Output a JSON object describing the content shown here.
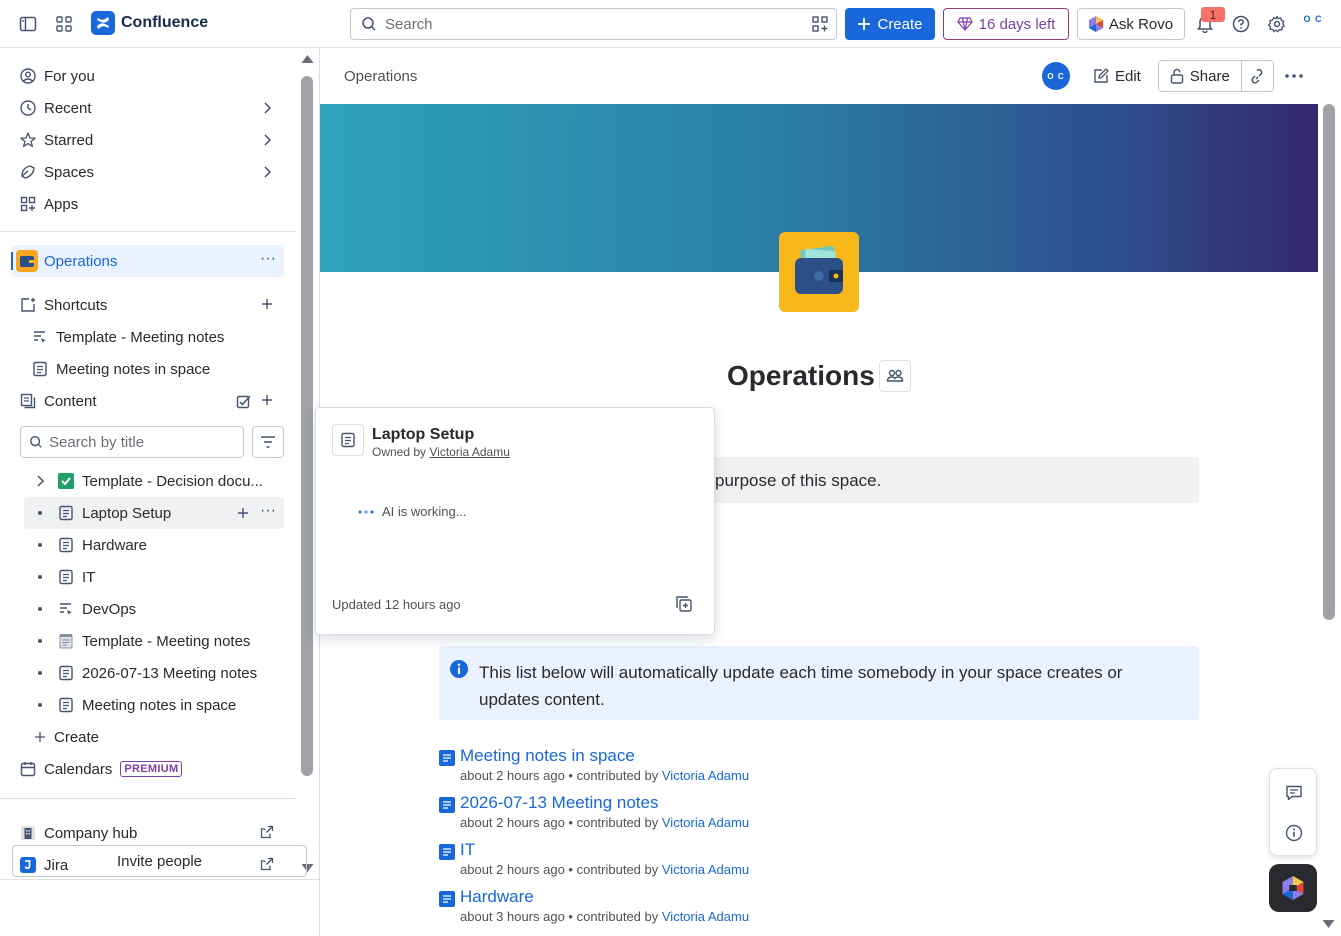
{
  "topbar": {
    "app_name": "Confluence",
    "search_placeholder": "Search",
    "create_label": "Create",
    "trial_label": "16 days left",
    "rovo_label": "Ask Rovo",
    "notification_count": "1",
    "profile_initials": "O C"
  },
  "sidebar": {
    "nav": [
      {
        "label": "For you"
      },
      {
        "label": "Recent"
      },
      {
        "label": "Starred"
      },
      {
        "label": "Spaces"
      },
      {
        "label": "Apps"
      }
    ],
    "space_name": "Operations",
    "shortcuts_label": "Shortcuts",
    "shortcuts": [
      {
        "label": "Template - Meeting notes"
      },
      {
        "label": "Meeting notes in space"
      }
    ],
    "content_label": "Content",
    "search_title_placeholder": "Search by title",
    "tree": [
      {
        "label": "Template - Decision docu..."
      },
      {
        "label": "Laptop Setup"
      },
      {
        "label": "Hardware"
      },
      {
        "label": "IT"
      },
      {
        "label": "DevOps"
      },
      {
        "label": "Template - Meeting notes"
      },
      {
        "label": "2026-07-13 Meeting notes"
      },
      {
        "label": "Meeting notes in space"
      }
    ],
    "create_label": "Create",
    "calendars_label": "Calendars",
    "premium_badge": "PREMIUM",
    "company_hub_label": "Company hub",
    "jira_label": "Jira",
    "invite_label": "Invite people"
  },
  "main": {
    "breadcrumb": "Operations",
    "avatar_initials": "O C",
    "edit_label": "Edit",
    "share_label": "Share",
    "title": "Operations",
    "purpose_text": "purpose of this space.",
    "info_text": "This list below will automatically update each time somebody in your space creates or updates content.",
    "items": [
      {
        "title": "Meeting notes in space",
        "time": "about 2 hours ago",
        "sep": " • contributed by ",
        "who": "Victoria Adamu"
      },
      {
        "title": "2026-07-13 Meeting notes",
        "time": "about 2 hours ago",
        "sep": " • contributed by ",
        "who": "Victoria Adamu"
      },
      {
        "title": "IT",
        "time": "about 2 hours ago",
        "sep": " • contributed by ",
        "who": "Victoria Adamu"
      },
      {
        "title": "Hardware",
        "time": "about 3 hours ago",
        "sep": " • contributed by ",
        "who": "Victoria Adamu"
      }
    ]
  },
  "hover_card": {
    "title": "Laptop Setup",
    "owned_by": "Owned by ",
    "owner": "Victoria Adamu",
    "ai_status": "AI is working...",
    "updated": "Updated 12 hours ago"
  },
  "colors": {
    "brand": "#1868db",
    "trial": "#803fa5",
    "space_icon": "#f8b81c"
  }
}
